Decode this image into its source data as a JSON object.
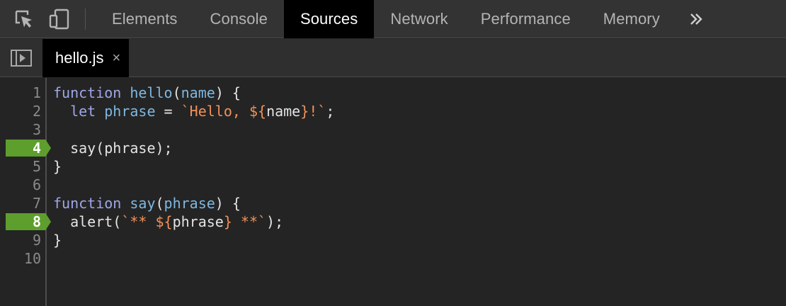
{
  "toolbar": {
    "inspect_icon": "inspect-element-icon",
    "device_icon": "device-toggle-icon",
    "tabs": [
      {
        "label": "Elements",
        "active": false
      },
      {
        "label": "Console",
        "active": false
      },
      {
        "label": "Sources",
        "active": true
      },
      {
        "label": "Network",
        "active": false
      },
      {
        "label": "Performance",
        "active": false
      },
      {
        "label": "Memory",
        "active": false
      }
    ],
    "more_label": "»"
  },
  "filebar": {
    "nav_icon": "toggle-navigator-icon",
    "file_name": "hello.js",
    "close_glyph": "×"
  },
  "colors": {
    "keyword": "#9fa6e8",
    "identifier": "#7fb8e0",
    "string": "#f0915a",
    "breakpoint": "#5e9e2d",
    "active_tab_bg": "#000000"
  },
  "editor": {
    "lines": [
      {
        "num": "1",
        "breakpoint": false,
        "tokens": [
          {
            "t": "function",
            "c": "kw"
          },
          {
            "t": " ",
            "c": "pn"
          },
          {
            "t": "hello",
            "c": "fn"
          },
          {
            "t": "(",
            "c": "pn"
          },
          {
            "t": "name",
            "c": "pm"
          },
          {
            "t": ") {",
            "c": "pn"
          }
        ]
      },
      {
        "num": "2",
        "breakpoint": false,
        "tokens": [
          {
            "t": "  ",
            "c": "pn"
          },
          {
            "t": "let",
            "c": "kw"
          },
          {
            "t": " ",
            "c": "pn"
          },
          {
            "t": "phrase",
            "c": "pm"
          },
          {
            "t": " = ",
            "c": "pn"
          },
          {
            "t": "`Hello, ${",
            "c": "str"
          },
          {
            "t": "name",
            "c": "pn"
          },
          {
            "t": "}!`",
            "c": "str"
          },
          {
            "t": ";",
            "c": "pn"
          }
        ]
      },
      {
        "num": "3",
        "breakpoint": false,
        "tokens": []
      },
      {
        "num": "4",
        "breakpoint": true,
        "tokens": [
          {
            "t": "  say(phrase);",
            "c": "pn"
          }
        ]
      },
      {
        "num": "5",
        "breakpoint": false,
        "tokens": [
          {
            "t": "}",
            "c": "pn"
          }
        ]
      },
      {
        "num": "6",
        "breakpoint": false,
        "tokens": []
      },
      {
        "num": "7",
        "breakpoint": false,
        "tokens": [
          {
            "t": "function",
            "c": "kw"
          },
          {
            "t": " ",
            "c": "pn"
          },
          {
            "t": "say",
            "c": "fn"
          },
          {
            "t": "(",
            "c": "pn"
          },
          {
            "t": "phrase",
            "c": "pm"
          },
          {
            "t": ") {",
            "c": "pn"
          }
        ]
      },
      {
        "num": "8",
        "breakpoint": true,
        "tokens": [
          {
            "t": "  alert(",
            "c": "pn"
          },
          {
            "t": "`** ${",
            "c": "str"
          },
          {
            "t": "phrase",
            "c": "pn"
          },
          {
            "t": "} **`",
            "c": "str"
          },
          {
            "t": ");",
            "c": "pn"
          }
        ]
      },
      {
        "num": "9",
        "breakpoint": false,
        "tokens": [
          {
            "t": "}",
            "c": "pn"
          }
        ]
      },
      {
        "num": "10",
        "breakpoint": false,
        "tokens": []
      }
    ]
  }
}
